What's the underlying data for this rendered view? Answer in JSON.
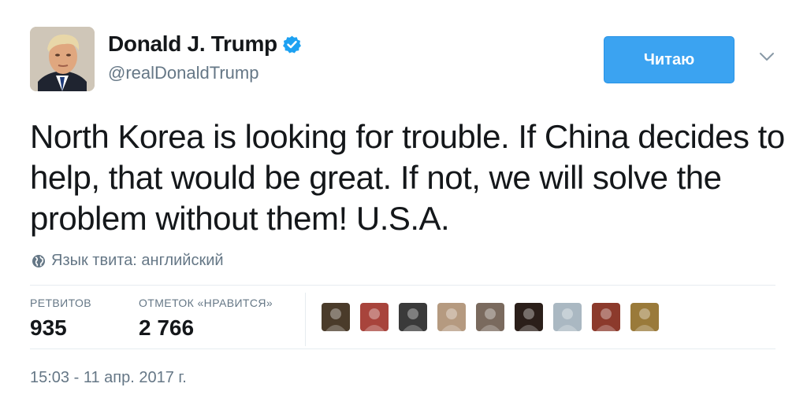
{
  "author": {
    "name": "Donald J. Trump",
    "handle": "@realDonaldTrump",
    "verified": true
  },
  "follow_button": {
    "label": "Читаю"
  },
  "tweet": {
    "text": "North Korea is looking for trouble. If China decides to help, that would be great. If not, we will solve the problem without them!  U.S.A."
  },
  "language_note": "Язык твита: английский",
  "stats": {
    "retweets_label": "РЕТВИТОВ",
    "retweets_value": "935",
    "likes_label": "ОТМЕТОК «НРАВИТСЯ»",
    "likes_value": "2 766"
  },
  "likers": [
    {
      "color": "#4a3b2a"
    },
    {
      "color": "#a8443c"
    },
    {
      "color": "#3a3a3a"
    },
    {
      "color": "#b59a80"
    },
    {
      "color": "#7a6a5e"
    },
    {
      "color": "#2b1f1a"
    },
    {
      "color": "#aab8c2"
    },
    {
      "color": "#8c3a2c"
    },
    {
      "color": "#9a7a3a"
    }
  ],
  "timestamp": "15:03 - 11 апр. 2017 г.",
  "colors": {
    "accent": "#3ba3f1",
    "muted": "#657786",
    "divider": "#e6ecf0"
  }
}
